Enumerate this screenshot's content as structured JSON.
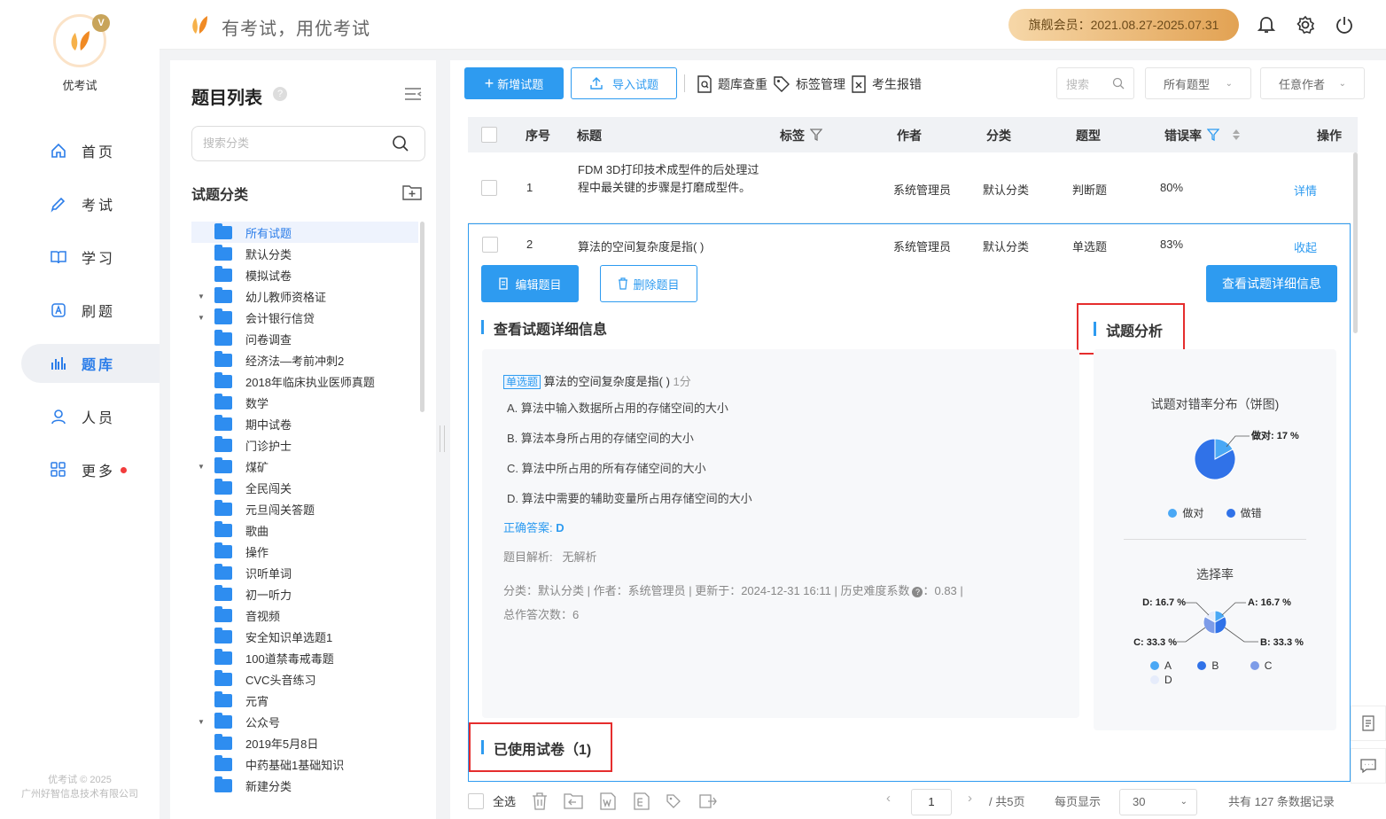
{
  "app": {
    "name": "优考试",
    "logo_badge": "V",
    "slogan": "有考试，用优考试",
    "vip": "旗舰会员：2021.08.27-2025.07.31",
    "copyright": "优考试 © 2025",
    "company": "广州好智信息技术有限公司",
    "accent": "#2e9bf0"
  },
  "nav": [
    {
      "label": "首页",
      "icon": "home-icon"
    },
    {
      "label": "考试",
      "icon": "pencil-icon"
    },
    {
      "label": "学习",
      "icon": "book-icon"
    },
    {
      "label": "刷题",
      "icon": "practice-icon"
    },
    {
      "label": "题库",
      "icon": "bank-icon",
      "active": true
    },
    {
      "label": "人员",
      "icon": "user-icon"
    },
    {
      "label": "更多",
      "icon": "apps-icon",
      "dot": true
    }
  ],
  "category": {
    "title": "题目列表",
    "help": "?",
    "search_placeholder": "搜索分类",
    "subtitle": "试题分类",
    "items": [
      {
        "label": "所有试题",
        "active": true,
        "arrow": false
      },
      {
        "label": "默认分类",
        "arrow": false
      },
      {
        "label": "模拟试卷",
        "arrow": false
      },
      {
        "label": "幼儿教师资格证",
        "arrow": true
      },
      {
        "label": "会计银行信贷",
        "arrow": true
      },
      {
        "label": "问卷调查",
        "arrow": false
      },
      {
        "label": "经济法—考前冲刺2",
        "arrow": false
      },
      {
        "label": "2018年临床执业医师真题",
        "arrow": false
      },
      {
        "label": "数学",
        "arrow": false
      },
      {
        "label": "期中试卷",
        "arrow": false
      },
      {
        "label": "门诊护士",
        "arrow": false
      },
      {
        "label": "煤矿",
        "arrow": true
      },
      {
        "label": "全民闯关",
        "arrow": false
      },
      {
        "label": "元旦闯关答题",
        "arrow": false
      },
      {
        "label": "歌曲",
        "arrow": false
      },
      {
        "label": "操作",
        "arrow": false
      },
      {
        "label": "识听单词",
        "arrow": false
      },
      {
        "label": "初一听力",
        "arrow": false
      },
      {
        "label": "音视频",
        "arrow": false
      },
      {
        "label": "安全知识单选题1",
        "arrow": false
      },
      {
        "label": "100道禁毒戒毒题",
        "arrow": false
      },
      {
        "label": "CVC头音练习",
        "arrow": false
      },
      {
        "label": "元宵",
        "arrow": false
      },
      {
        "label": "公众号",
        "arrow": true
      },
      {
        "label": "2019年5月8日",
        "arrow": false
      },
      {
        "label": "中药基础1基础知识",
        "arrow": false
      },
      {
        "label": "新建分类",
        "arrow": false
      }
    ]
  },
  "toolbar": {
    "add": "新增试题",
    "import": "导入试题",
    "dedupe": "题库查重",
    "tags": "标签管理",
    "errors": "考生报错",
    "search_placeholder": "搜索",
    "type_select": "所有题型",
    "author_select": "任意作者"
  },
  "table": {
    "headers": {
      "no": "序号",
      "title": "标题",
      "tag": "标签",
      "author": "作者",
      "category": "分类",
      "type": "题型",
      "error_rate": "错误率",
      "action": "操作"
    },
    "rows": [
      {
        "no": "1",
        "title": "FDM 3D打印技术成型件的后处理过程中最关键的步骤是打磨成型件。",
        "author": "系统管理员",
        "category": "默认分类",
        "type": "判断题",
        "error_rate": "80%",
        "action": "详情"
      },
      {
        "no": "2",
        "title": "算法的空间复杂度是指( )",
        "author": "系统管理员",
        "category": "默认分类",
        "type": "单选题",
        "error_rate": "83%",
        "action": "收起"
      }
    ]
  },
  "detail": {
    "edit": "编辑题目",
    "delete": "删除题目",
    "view_detail": "查看试题详细信息",
    "section_title": "查看试题详细信息",
    "analysis_title": "试题分析",
    "q_type": "单选题",
    "q_text": "算法的空间复杂度是指( )",
    "q_score": "1分",
    "options": [
      "A. 算法中输入数据所占用的存储空间的大小",
      "B. 算法本身所占用的存储空间的大小",
      "C. 算法中所占用的所有存储空间的大小",
      "D. 算法中需要的辅助变量所占用存储空间的大小"
    ],
    "answer_label": "正确答案:",
    "answer": "D",
    "analysis_text": "题目解析:   无解析",
    "meta_line1": "分类：默认分类 | 作者：系统管理员 | 更新于：2024-12-31 16:11 | 历史难度系数",
    "meta_value": "：0.83 |",
    "meta_line2": "总作答次数：6",
    "used_papers": "已使用试卷（1)"
  },
  "chart_data": [
    {
      "type": "pie",
      "title": "试题对错率分布（饼图)",
      "categories": [
        "做对",
        "做错"
      ],
      "values": [
        17,
        83
      ],
      "labels": [
        "做对: 17 %"
      ],
      "colors": [
        "#4aa8f5",
        "#3072e8"
      ]
    },
    {
      "type": "pie",
      "title": "选择率",
      "categories": [
        "A",
        "B",
        "C",
        "D"
      ],
      "values": [
        16.7,
        33.3,
        33.3,
        16.7
      ],
      "labels": [
        "A: 16.7 %",
        "B: 33.3 %",
        "C: 33.3 %",
        "D: 16.7 %"
      ],
      "colors": [
        "#4aa8f5",
        "#3072e8",
        "#7d9ce8",
        "#e6ecfb"
      ]
    }
  ],
  "footer": {
    "select_all": "全选",
    "page": "1",
    "total_pages": "/ 共5页",
    "per_page_label": "每页显示",
    "per_page": "30",
    "total": "共有 127 条数据记录"
  }
}
